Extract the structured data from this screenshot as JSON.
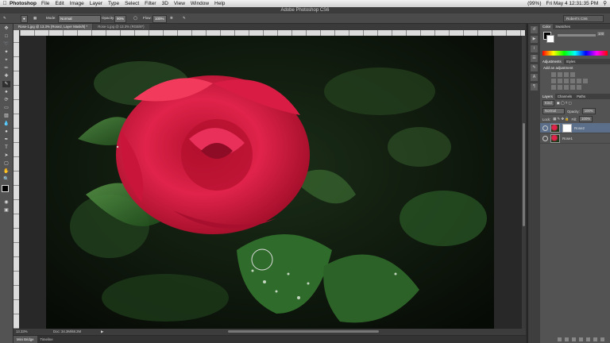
{
  "menubar": {
    "app": "Photoshop",
    "items": [
      "File",
      "Edit",
      "Image",
      "Layer",
      "Type",
      "Select",
      "Filter",
      "3D",
      "View",
      "Window",
      "Help"
    ],
    "battery": "(99%)",
    "clock": "Fri May 4  12:31:35 PM"
  },
  "window": {
    "title": "Adobe Photoshop CS6"
  },
  "options": {
    "mode_label": "Mode:",
    "mode_value": "Normal",
    "opacity_label": "Opacity:",
    "opacity_value": "90%",
    "flow_label": "Flow:",
    "flow_value": "100%",
    "workspace": "Robert's CS6"
  },
  "tabs": [
    {
      "label": "Rose-1.jpg @ 13.3% (Rose2, Layer Mask/8) *"
    },
    {
      "label": "Rose-1.jpg @ 13.3% (RGB/8*)"
    }
  ],
  "status": {
    "zoom": "13.33%",
    "doc": "Doc: 34.3M/68.2M"
  },
  "bottom_tabs": [
    "Mini Bridge",
    "Timeline"
  ],
  "panels": {
    "color_tabs": [
      "Color",
      "Swatches"
    ],
    "color_value": "100",
    "adj_tabs": [
      "Adjustments",
      "Styles"
    ],
    "adj_title": "Add an adjustment",
    "layers_tabs": [
      "Layers",
      "Channels",
      "Paths"
    ],
    "kind": "Kind",
    "blend": "Normal",
    "opacity_label": "Opacity:",
    "opacity": "100%",
    "lock_label": "Lock:",
    "fill_label": "Fill:",
    "fill": "100%",
    "layers": [
      {
        "name": "Rose2",
        "selected": true,
        "mask": true
      },
      {
        "name": "Rose1",
        "selected": false,
        "mask": false
      }
    ]
  },
  "colors": {
    "accent": "#5b6f8b",
    "rose": "#e0234a",
    "leaf": "#2f6b2a"
  }
}
